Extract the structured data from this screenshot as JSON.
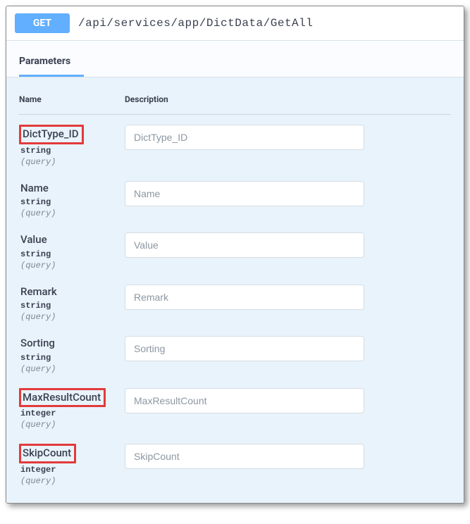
{
  "method": "GET",
  "endpoint": "/api/services/app/DictData/GetAll",
  "tabs": {
    "parameters_label": "Parameters"
  },
  "columns": {
    "name": "Name",
    "description": "Description"
  },
  "params": [
    {
      "name": "DictType_ID",
      "type": "string",
      "in": "(query)",
      "placeholder": "DictType_ID",
      "highlighted": true
    },
    {
      "name": "Name",
      "type": "string",
      "in": "(query)",
      "placeholder": "Name",
      "highlighted": false
    },
    {
      "name": "Value",
      "type": "string",
      "in": "(query)",
      "placeholder": "Value",
      "highlighted": false
    },
    {
      "name": "Remark",
      "type": "string",
      "in": "(query)",
      "placeholder": "Remark",
      "highlighted": false
    },
    {
      "name": "Sorting",
      "type": "string",
      "in": "(query)",
      "placeholder": "Sorting",
      "highlighted": false
    },
    {
      "name": "MaxResultCount",
      "type": "integer",
      "in": "(query)",
      "placeholder": "MaxResultCount",
      "highlighted": true
    },
    {
      "name": "SkipCount",
      "type": "integer",
      "in": "(query)",
      "placeholder": "SkipCount",
      "highlighted": true
    }
  ]
}
